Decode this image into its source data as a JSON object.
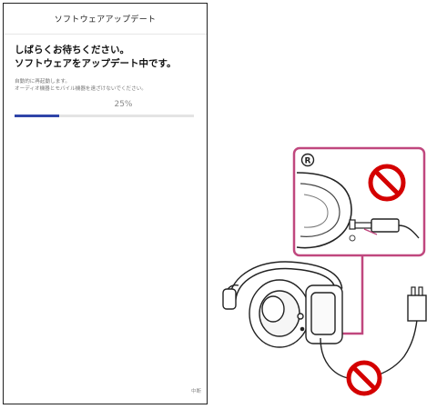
{
  "screen": {
    "title": "ソフトウェアアップデート",
    "headline_line1": "しばらくお待ちください。",
    "headline_line2": "ソフトウェアをアップデート中です。",
    "note_line1": "自動的に再起動します。",
    "note_line2": "オーディオ機器とモバイル機器を遠ざけないでください。",
    "progress_label": "25%",
    "progress_value": 0.25,
    "footer_label": "中断"
  },
  "illustration": {
    "callout_mark": "R",
    "prohibited_icon": "no-symbol-icon",
    "accent_color": "#c0477e",
    "prohibit_color": "#d40000"
  }
}
